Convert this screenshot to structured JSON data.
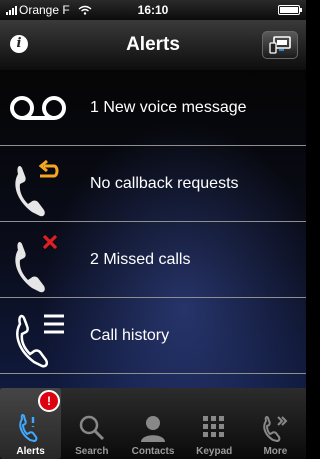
{
  "status_bar": {
    "carrier": "Orange F",
    "time": "16:10"
  },
  "nav": {
    "title": "Alerts",
    "info_icon_glyph": "i"
  },
  "alerts": [
    {
      "icon": "voicemail-icon",
      "label": "1 New voice message"
    },
    {
      "icon": "callback-icon",
      "label": "No callback requests"
    },
    {
      "icon": "missed-call-icon",
      "label": "2  Missed calls"
    },
    {
      "icon": "call-history-icon",
      "label": "Call history"
    }
  ],
  "tabs": [
    {
      "label": "Alerts",
      "icon": "alerts-phone-icon",
      "badge": "!",
      "selected": true
    },
    {
      "label": "Search",
      "icon": "search-icon",
      "selected": false
    },
    {
      "label": "Contacts",
      "icon": "contacts-icon",
      "selected": false
    },
    {
      "label": "Keypad",
      "icon": "keypad-icon",
      "selected": false
    },
    {
      "label": "More",
      "icon": "more-icon",
      "selected": false
    }
  ],
  "colors": {
    "accent_orange": "#f5a623",
    "missed_red": "#e02020",
    "badge_red": "#dd1111"
  }
}
